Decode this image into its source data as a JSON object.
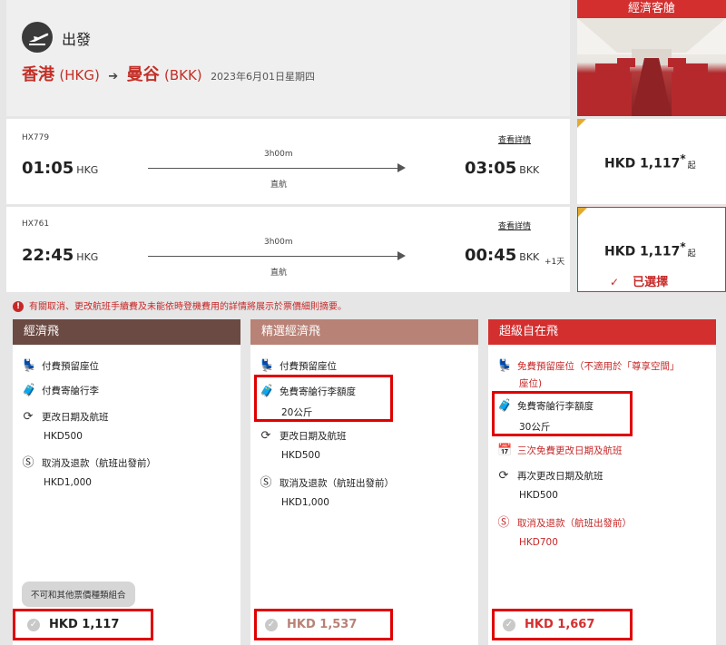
{
  "header": {
    "depart_label": "出發",
    "origin_city": "香港",
    "origin_code": "(HKG)",
    "arrow": "➔",
    "dest_city": "曼谷",
    "dest_code": "(BKK)",
    "date": "2023年6月01日星期四",
    "plane_icon": "plane-departure-icon"
  },
  "cabin": {
    "title": "經濟客艙"
  },
  "flights": [
    {
      "number": "HX779",
      "dep_time": "01:05",
      "dep_port": "HKG",
      "duration": "3h00m",
      "type": "直航",
      "arr_time": "03:05",
      "arr_port": "BKK",
      "plus_day": "",
      "details": "查看詳情",
      "price": "HKD 1,117",
      "star": "*",
      "qi": "起",
      "selected": ""
    },
    {
      "number": "HX761",
      "dep_time": "22:45",
      "dep_port": "HKG",
      "duration": "3h00m",
      "type": "直航",
      "arr_time": "00:45",
      "arr_port": "BKK",
      "plus_day": "+1天",
      "details": "查看詳情",
      "price": "HKD 1,117",
      "star": "*",
      "qi": "起",
      "selected": "已選擇"
    }
  ],
  "notice": "有關取消、更改航班手續費及未能依時登機費用的詳情將展示於票價細則摘要。",
  "fares": [
    {
      "title": "經濟飛",
      "color": "#6b4a43",
      "items": [
        {
          "icon": "seat-icon",
          "text": "付費預留座位",
          "sub": ""
        },
        {
          "icon": "luggage-icon",
          "text": "付費寄艙行李",
          "sub": ""
        },
        {
          "icon": "change-icon",
          "text": "更改日期及航班",
          "sub": "HKD500"
        },
        {
          "icon": "refund-icon",
          "text": "取消及退款（航班出發前）",
          "sub": "HKD1,000"
        }
      ],
      "badge": "不可和其他票價種類組合",
      "total": "HKD 1,117",
      "total_color": "#222"
    },
    {
      "title": "精選經濟飛",
      "color": "#b88276",
      "items": [
        {
          "icon": "seat-icon",
          "text": "付費預留座位",
          "sub": ""
        },
        {
          "icon": "luggage-icon",
          "text": "免費寄艙行李額度",
          "sub": "20公斤"
        },
        {
          "icon": "change-icon",
          "text": "更改日期及航班",
          "sub": "HKD500"
        },
        {
          "icon": "refund-icon",
          "text": "取消及退款（航班出發前）",
          "sub": "HKD1,000"
        }
      ],
      "total": "HKD 1,537",
      "total_color": "#b88276"
    },
    {
      "title": "超級自在飛",
      "color": "#d32f2f",
      "items": [
        {
          "icon": "seat-icon",
          "text": "免費預留座位（不適用於「尊享空間」",
          "sub": "座位)"
        },
        {
          "icon": "luggage-icon",
          "text": "免費寄艙行李額度",
          "sub": "30公斤"
        },
        {
          "icon": "calendar-check-icon",
          "text": "三次免費更改日期及航班",
          "sub": ""
        },
        {
          "icon": "change-icon",
          "text": "再次更改日期及航班",
          "sub": "HKD500"
        },
        {
          "icon": "refund-icon",
          "text": "取消及退款（航班出發前）",
          "sub": "HKD700"
        }
      ],
      "total": "HKD 1,667",
      "total_color": "#d32f2f"
    }
  ]
}
